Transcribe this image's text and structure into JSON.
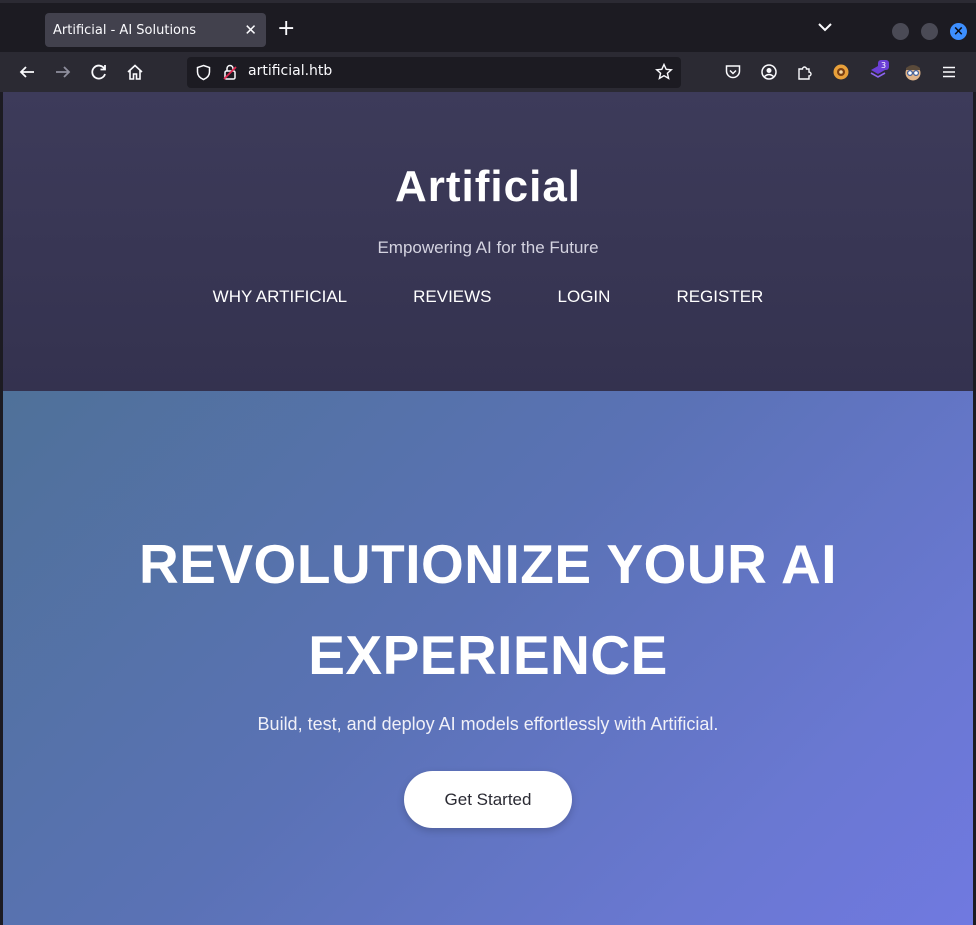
{
  "browser": {
    "tab_title": "Artificial - AI Solutions",
    "url": "artificial.htb",
    "extension_badge": "3",
    "icons": [
      "back-icon",
      "forward-icon",
      "reload-icon",
      "home-icon",
      "shield-icon",
      "lock-icon",
      "bookmark-star-icon",
      "pocket-icon",
      "account-icon",
      "extensions-icon",
      "menu-icon"
    ]
  },
  "header": {
    "brand": "Artificial",
    "tagline": "Empowering AI for the Future",
    "nav": [
      "WHY ARTIFICIAL",
      "REVIEWS",
      "LOGIN",
      "REGISTER"
    ]
  },
  "hero": {
    "title": "REVOLUTIONIZE YOUR AI EXPERIENCE",
    "subtitle": "Build, test, and deploy AI models effortlessly with Artificial.",
    "cta": "Get Started"
  },
  "colors": {
    "header_bg": "#3a3856",
    "hero_start": "#4f7199",
    "hero_end": "#7079e0",
    "accent": "#3d8fff"
  }
}
